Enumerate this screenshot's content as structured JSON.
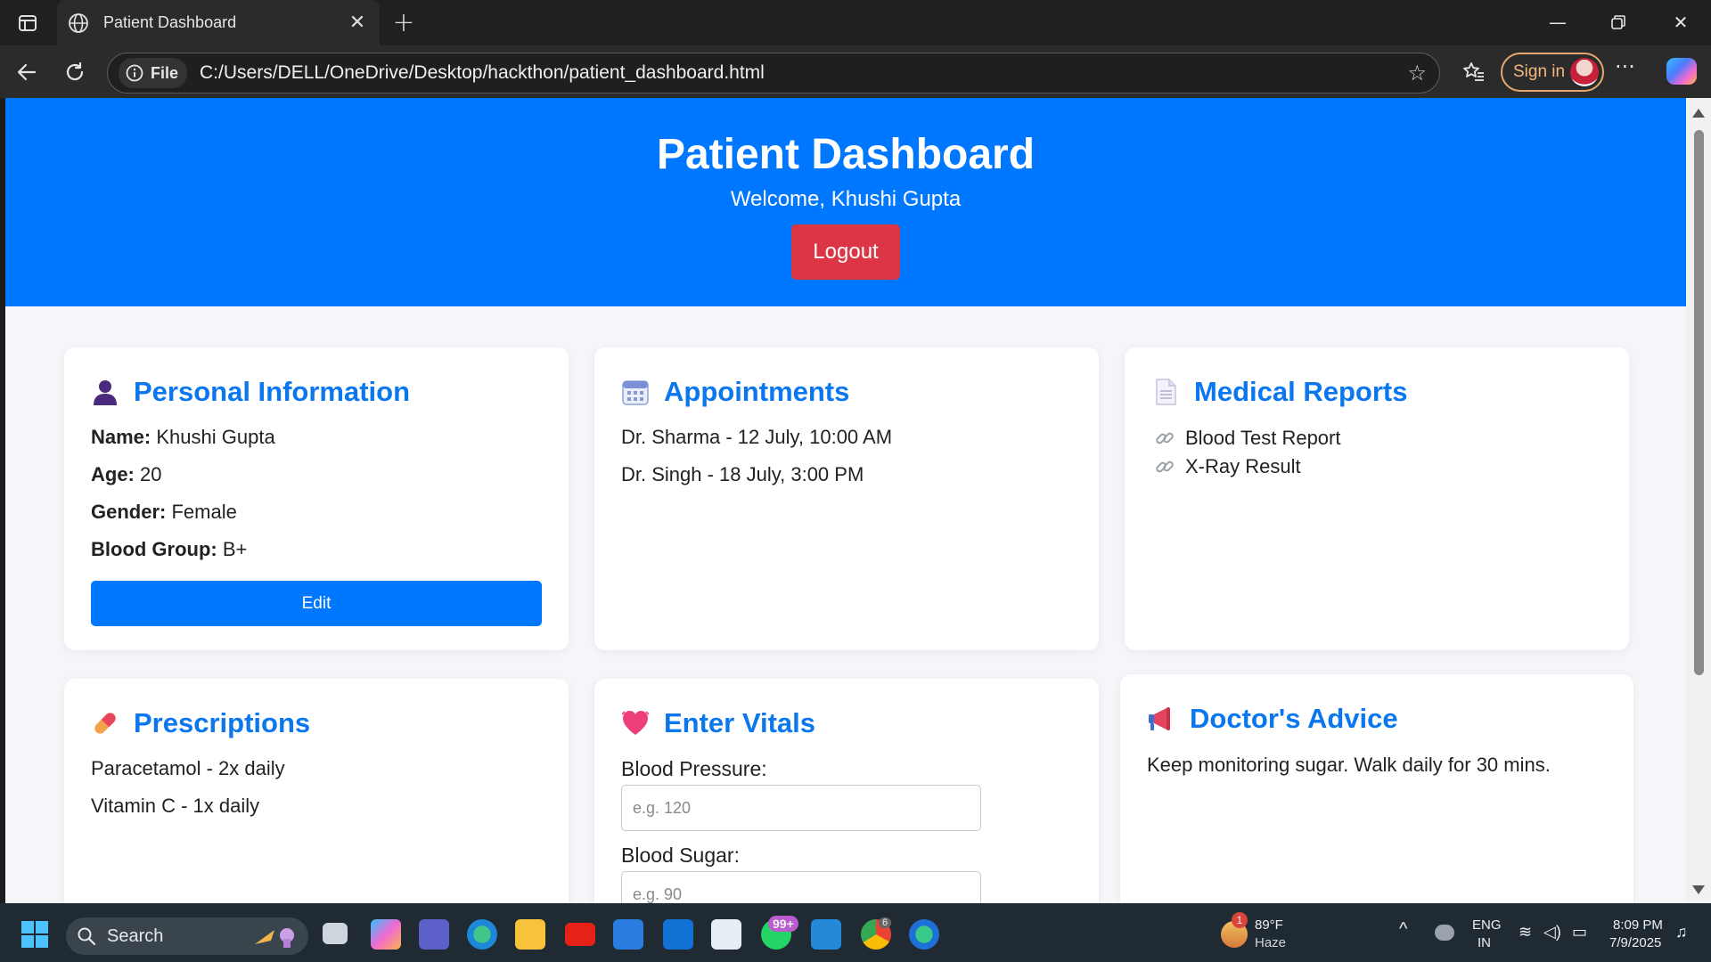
{
  "browser": {
    "tab_title": "Patient Dashboard",
    "site_label": "File",
    "url": "C:/Users/DELL/OneDrive/Desktop/hackthon/patient_dashboard.html",
    "signin_label": "Sign in"
  },
  "header": {
    "title": "Patient Dashboard",
    "welcome": "Welcome, Khushi Gupta",
    "logout_label": "Logout",
    "color": "#0077ff",
    "logout_color": "#dc3545"
  },
  "personal": {
    "title": "Personal Information",
    "icon": "person-icon",
    "fields": [
      {
        "label": "Name:",
        "value": "Khushi Gupta"
      },
      {
        "label": "Age:",
        "value": "20"
      },
      {
        "label": "Gender:",
        "value": "Female"
      },
      {
        "label": "Blood Group:",
        "value": "B+"
      }
    ],
    "edit_label": "Edit"
  },
  "appointments": {
    "title": "Appointments",
    "icon": "calendar-icon",
    "items": [
      "Dr. Sharma - 12 July, 10:00 AM",
      "Dr. Singh - 18 July, 3:00 PM"
    ]
  },
  "reports": {
    "title": "Medical Reports",
    "icon": "document-icon",
    "items": [
      "Blood Test Report",
      "X-Ray Result"
    ]
  },
  "prescriptions": {
    "title": "Prescriptions",
    "icon": "pill-icon",
    "items": [
      "Paracetamol - 2x daily",
      "Vitamin C - 1x daily"
    ]
  },
  "vitals": {
    "title": "Enter Vitals",
    "icon": "heart-icon",
    "bp_label": "Blood Pressure:",
    "bp_placeholder": "e.g. 120",
    "sugar_label": "Blood Sugar:",
    "sugar_placeholder": "e.g. 90"
  },
  "advice": {
    "title": "Doctor's Advice",
    "icon": "megaphone-icon",
    "text": "Keep monitoring sugar. Walk daily for 30 mins."
  },
  "taskbar": {
    "search_label": "Search",
    "weather_temp": "89°F",
    "weather_desc": "Haze",
    "weather_badge": "1",
    "whatsapp_badge": "99+",
    "chrome_badge": "6",
    "lang_top": "ENG",
    "lang_bottom": "IN",
    "time": "8:09 PM",
    "date": "7/9/2025"
  }
}
